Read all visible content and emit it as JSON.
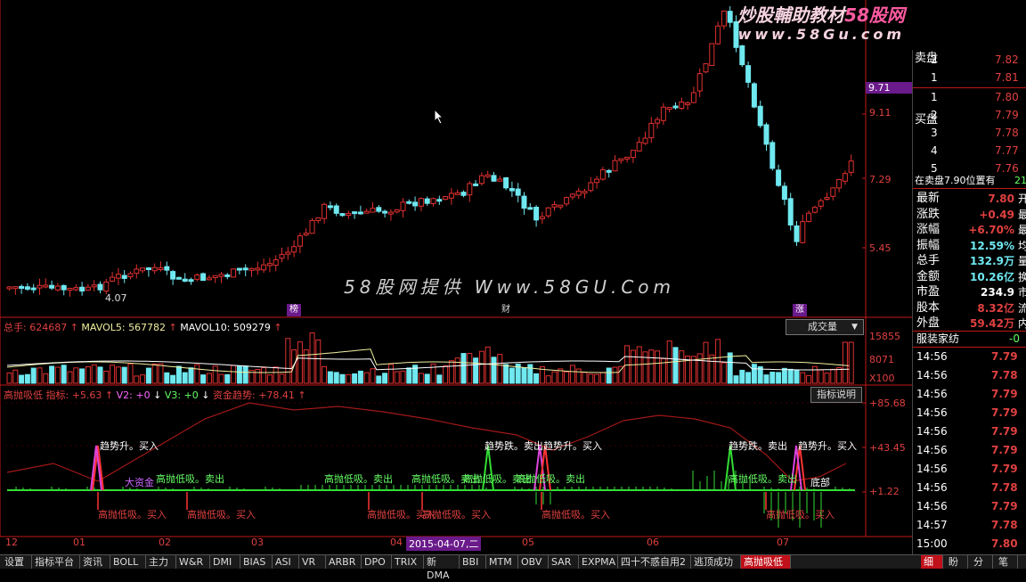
{
  "watermark": {
    "line1_a": "炒股輔助教材",
    "line1_b": "58股网",
    "line2": "www.58Gu.com"
  },
  "watermark_mid": "58股网提供 Www.58GU.Com",
  "price_axis": [
    "9.71",
    "9.11",
    "7.29",
    "5.45"
  ],
  "price_low_label": "4.07",
  "event_tags": [
    "榜",
    "财",
    "涨"
  ],
  "volume_header": {
    "total_label": "总手",
    "total_value": "624687",
    "mavol5_label": "MAVOL5",
    "mavol5_value": "567782",
    "mavol10_label": "MAVOL10",
    "mavol10_value": "509279"
  },
  "volume_dropdown": "成交量",
  "volume_axis": [
    "15855",
    "8071",
    "X100"
  ],
  "indicator_header": {
    "name": "高抛吸低",
    "ind_label": "指标",
    "ind_value": "+5.63",
    "v2_label": "V2",
    "v2_value": "+0",
    "v3_label": "V3",
    "v3_value": "+0",
    "trend_label": "资金趋势",
    "trend_value": "+78.41"
  },
  "indicator_button": "指标说明",
  "indicator_axis": [
    "+85.68",
    "+43.45",
    "+1.22"
  ],
  "signals": [
    {
      "text": "趋势升。买入"
    },
    {
      "text": "大资金"
    },
    {
      "text": "高抛低吸。卖出"
    },
    {
      "text": "高抛低吸。买入"
    },
    {
      "text": "高抛低吸。买入"
    },
    {
      "text": "高抛低吸。卖出"
    },
    {
      "text": "高抛低吸。卖出"
    },
    {
      "text": "高抛低吸。卖出"
    },
    {
      "text": "高抛低吸。买入"
    },
    {
      "text": "高抛低吸。买入"
    },
    {
      "text": "趋势跌。卖出"
    },
    {
      "text": "趋势升。买入"
    },
    {
      "text": "高抛低吸。卖出"
    },
    {
      "text": "高抛低吸。买入"
    },
    {
      "text": "高抛低吸。买入"
    },
    {
      "text": "趋势跌。卖出"
    },
    {
      "text": "趋势升。买入"
    },
    {
      "text": "高抛低吸。卖出"
    },
    {
      "text": "底部"
    },
    {
      "text": "高抛低吸。买入"
    }
  ],
  "x_axis": [
    "12",
    "01",
    "02",
    "03",
    "04",
    "2015-04-07,二",
    "05",
    "06",
    "07"
  ],
  "order_book": {
    "sell_label": "卖盘",
    "buy_label": "买盘",
    "sell": [
      {
        "level": "2",
        "price": "7.82"
      },
      {
        "level": "1",
        "price": "7.81"
      }
    ],
    "buy": [
      {
        "level": "1",
        "price": "7.80"
      },
      {
        "level": "2",
        "price": "7.79"
      },
      {
        "level": "3",
        "price": "7.78"
      },
      {
        "level": "4",
        "price": "7.77"
      },
      {
        "level": "5",
        "price": "7.76"
      }
    ],
    "note": "在卖盘7.90位置有",
    "note_extra": "21"
  },
  "quote": [
    {
      "label": "最新",
      "value": "7.80",
      "extra": "开"
    },
    {
      "label": "涨跌",
      "value": "+0.49",
      "extra": "最"
    },
    {
      "label": "涨幅",
      "value": "+6.70%",
      "extra": "最"
    },
    {
      "label": "振幅",
      "value": "12.59%",
      "extra": "均"
    },
    {
      "label": "总手",
      "value": "132.9万",
      "extra": "量"
    },
    {
      "label": "金额",
      "value": "10.26亿",
      "extra": "换"
    },
    {
      "label": "市盈",
      "value": "234.9",
      "extra": "市"
    },
    {
      "label": "股本",
      "value": "8.32亿",
      "extra": "流"
    },
    {
      "label": "外盘",
      "value": "59.42万",
      "extra": "内"
    }
  ],
  "industry": {
    "name": "服装家纺",
    "value": "-0"
  },
  "ticks": [
    {
      "time": "14:56",
      "price": "7.79"
    },
    {
      "time": "14:56",
      "price": "7.78"
    },
    {
      "time": "14:56",
      "price": "7.79"
    },
    {
      "time": "14:56",
      "price": "7.79"
    },
    {
      "time": "14:56",
      "price": "7.79"
    },
    {
      "time": "14:56",
      "price": "7.79"
    },
    {
      "time": "14:56",
      "price": "7.79"
    },
    {
      "time": "14:56",
      "price": "7.78"
    },
    {
      "time": "14:56",
      "price": "7.79"
    },
    {
      "time": "14:57",
      "price": "7.78"
    },
    {
      "time": "15:00",
      "price": "7.80"
    }
  ],
  "tabs": [
    "设置",
    "指标平台",
    "资讯",
    "BOLL",
    "主力",
    "W&R",
    "DMI",
    "BIAS",
    "ASI",
    "VR",
    "ARBR",
    "DPO",
    "TRIX",
    "新DMA",
    "BBI",
    "MTM",
    "OBV",
    "SAR",
    "EXPMA",
    "四十不惑自用2",
    "逃顶成功",
    "高抛吸低"
  ],
  "tab_right": [
    "细",
    "盼",
    "分",
    "笔"
  ],
  "colors": {
    "up": "#e03030",
    "down": "#6fe8f0",
    "axis": "#c01818",
    "grid": "#5a0000"
  }
}
